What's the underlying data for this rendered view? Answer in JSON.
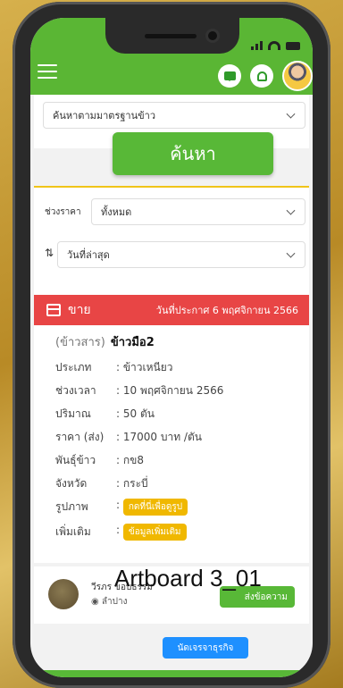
{
  "topbar": {
    "chat_icon": "chat-icon",
    "bell_icon": "bell-icon"
  },
  "filters": {
    "standard_select": "ค้นหาตามมาตรฐานข้าว",
    "search_button": "ค้นหา",
    "price_label": "ช่วงราคา",
    "price_value": "ทั้งหมด",
    "sort_value": "วันที่ล่าสุด"
  },
  "post": {
    "type": "ขาย",
    "date": "วันที่ประกาศ 6 พฤศจิกายน 2566",
    "title_prefix": "(ข้าวสาร)",
    "title": "ข้าวมือ2",
    "rows": [
      {
        "key": "ประเภท",
        "value": ": ข้าวเหนียว"
      },
      {
        "key": "ช่วงเวลา",
        "value": ": 10 พฤศจิกายน 2566"
      },
      {
        "key": "ปริมาณ",
        "value": ": 50 ตัน"
      },
      {
        "key": "ราคา (ส่ง)",
        "value": ": 17000 บาท /ตัน"
      },
      {
        "key": "พันธุ์ข้าว",
        "value": ": กข8"
      },
      {
        "key": "จังหวัด",
        "value": ": กระบี่"
      }
    ],
    "image_label": "รูปภาพ",
    "image_tag": "กดที่นี่เพื่อดูรูป",
    "more_label": "เพิ่มเติม",
    "more_tag": "ข้อมูลเพิ่มเติม"
  },
  "seller": {
    "name": "วีรภร ขอบธรรม",
    "location": "ลำปาง",
    "send_button": "ส่งข้อความ"
  },
  "watermark": "Artboard 3_01",
  "farmer_button": "นัดเจรจาธุรกิจ",
  "colors": {
    "accent": "#58b837",
    "post_header": "#e84545",
    "tag": "#f0b800"
  }
}
